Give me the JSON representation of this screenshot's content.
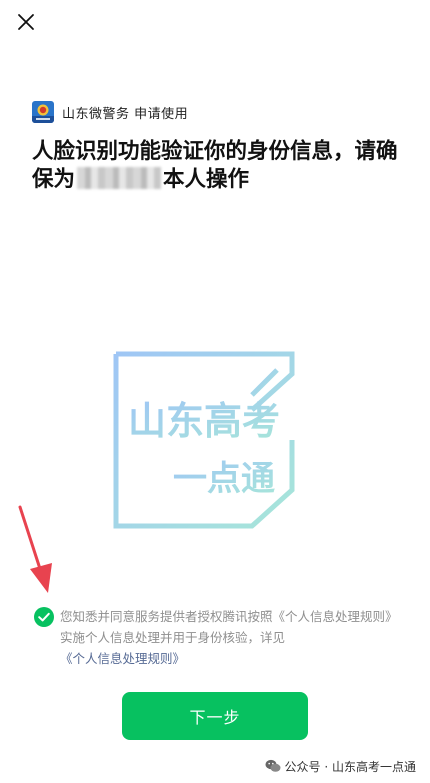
{
  "header": {
    "close_icon": "close-icon"
  },
  "app": {
    "name": "山东微警务 申请使用",
    "logo_icon": "police-badge-icon"
  },
  "headline": {
    "part1": "人脸识别功能验证你的身份信息，请确保为",
    "masked_name": "",
    "part2": "本人操作"
  },
  "watermark": {
    "line1": "山东高考",
    "line2": "一点通"
  },
  "consent": {
    "checked": true,
    "text": "您知悉并同意服务提供者授权腾讯按照《个人信息处理规则》实施个人信息处理并用于身份核验，详见",
    "link": "《个人信息处理规则》"
  },
  "next_button": {
    "label": "下一步"
  },
  "footer": {
    "label": "公众号 · 山东高考一点通",
    "icon": "wechat-icon"
  },
  "colors": {
    "primary": "#07c160",
    "link": "#576b95",
    "annotation_arrow": "#e8434f"
  }
}
